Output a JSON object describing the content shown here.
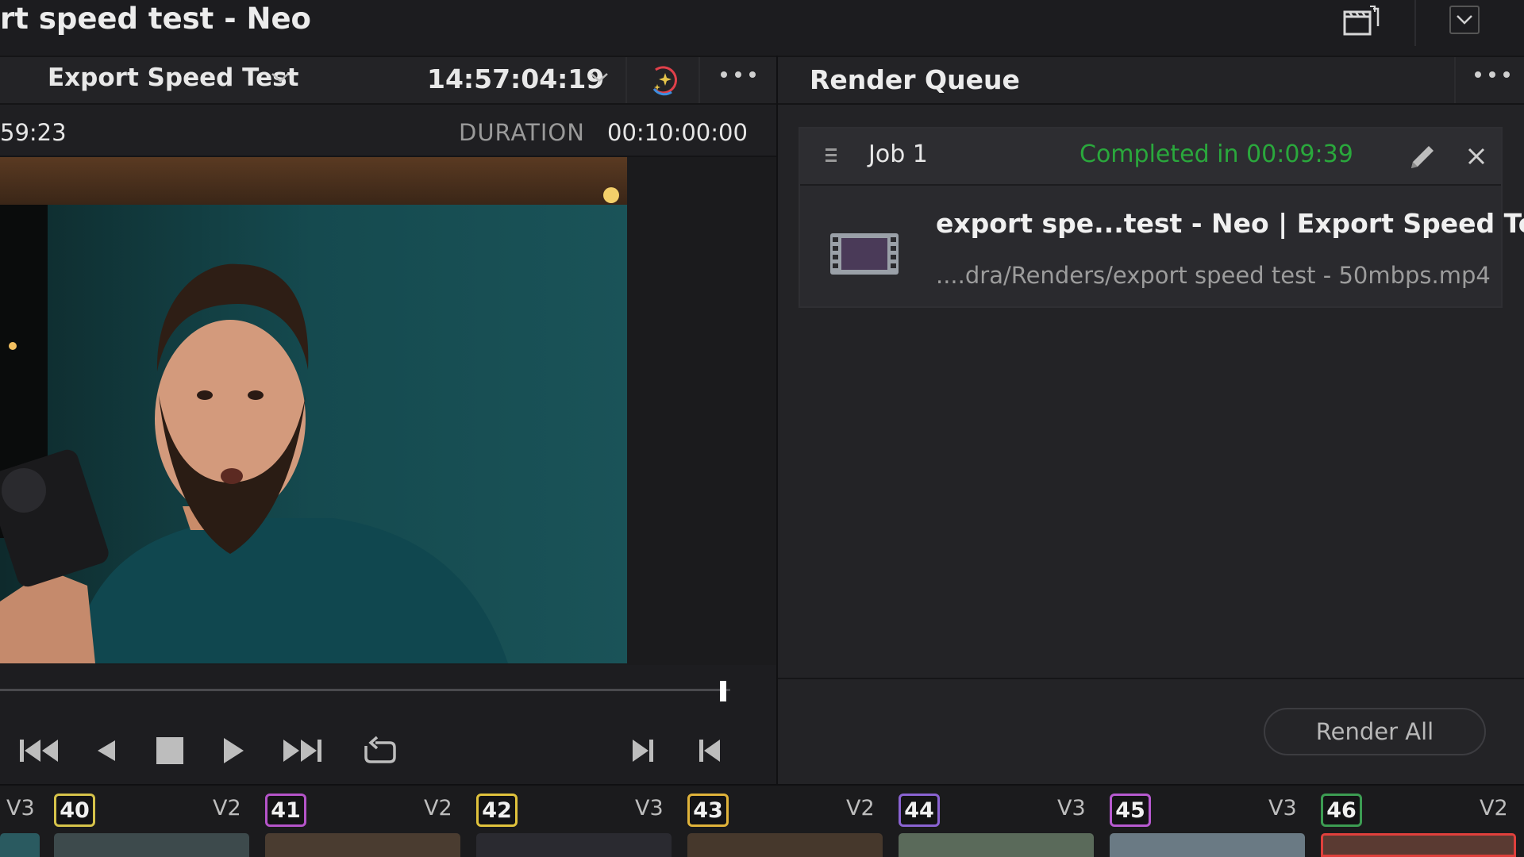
{
  "titlebar": {
    "project_title": "rt speed test - Neo",
    "clapper_icon": "clapperboard-icon",
    "collapse_icon": "chevron-down-icon"
  },
  "viewer": {
    "timeline_name": "Export Speed Test",
    "timecode": "14:57:04:19",
    "timecode_left": "59:23",
    "duration_label": "DURATION",
    "duration_value": "00:10:00:00",
    "playhead_position_fraction": 0.99
  },
  "transport": {
    "buttons": [
      "jump-to-start",
      "step-back",
      "stop",
      "play",
      "jump-to-end",
      "loop",
      "mark-out",
      "mark-in"
    ]
  },
  "render_queue": {
    "title": "Render Queue",
    "jobs": [
      {
        "name": "Job 1",
        "status": "Completed in 00:09:39",
        "title": "export spe...test - Neo | Export Speed Test",
        "path": "....dra/Renders/export speed test - 50mbps.mp4"
      }
    ],
    "render_all_label": "Render All"
  },
  "clips": [
    {
      "track": "V3",
      "number": "40",
      "color": "#d6c34a"
    },
    {
      "track": "V2",
      "number": "41",
      "color": "#b554c9"
    },
    {
      "track": "V2",
      "number": "42",
      "color": "#e0c23c"
    },
    {
      "track": "V3",
      "number": "43",
      "color": "#e0b33a"
    },
    {
      "track": "V2",
      "number": "44",
      "color": "#8a63d2"
    },
    {
      "track": "V3",
      "number": "45",
      "color": "#b75ad0"
    },
    {
      "track": "V3",
      "number": "46",
      "color": "#3c9c52"
    },
    {
      "track": "V2",
      "number": "",
      "color": ""
    }
  ],
  "colors": {
    "accent_green": "#2aa83c",
    "selected_clip_border": "#e0403c"
  }
}
